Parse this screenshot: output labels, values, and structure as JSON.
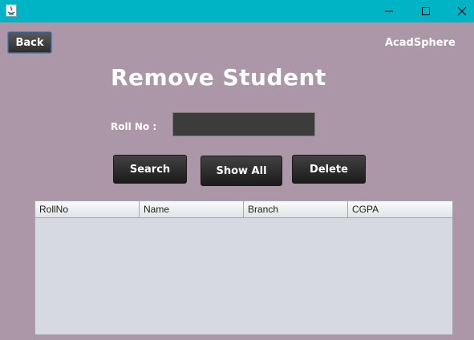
{
  "window": {
    "icon": "java-icon",
    "controls": [
      "minimize-icon",
      "maximize-icon",
      "close-icon"
    ]
  },
  "header": {
    "back_label": "Back",
    "brand": "AcadSphere"
  },
  "main": {
    "title": "Remove Student",
    "roll_label": "Roll No :",
    "roll_value": "",
    "buttons": {
      "search": "Search",
      "show_all": "Show All",
      "delete": "Delete"
    },
    "table": {
      "columns": [
        "RollNo",
        "Name",
        "Branch",
        "CGPA"
      ],
      "rows": []
    }
  },
  "colors": {
    "titlebar": "#00b4c5",
    "background": "#ab97a7",
    "button": "#2c2c2c"
  }
}
